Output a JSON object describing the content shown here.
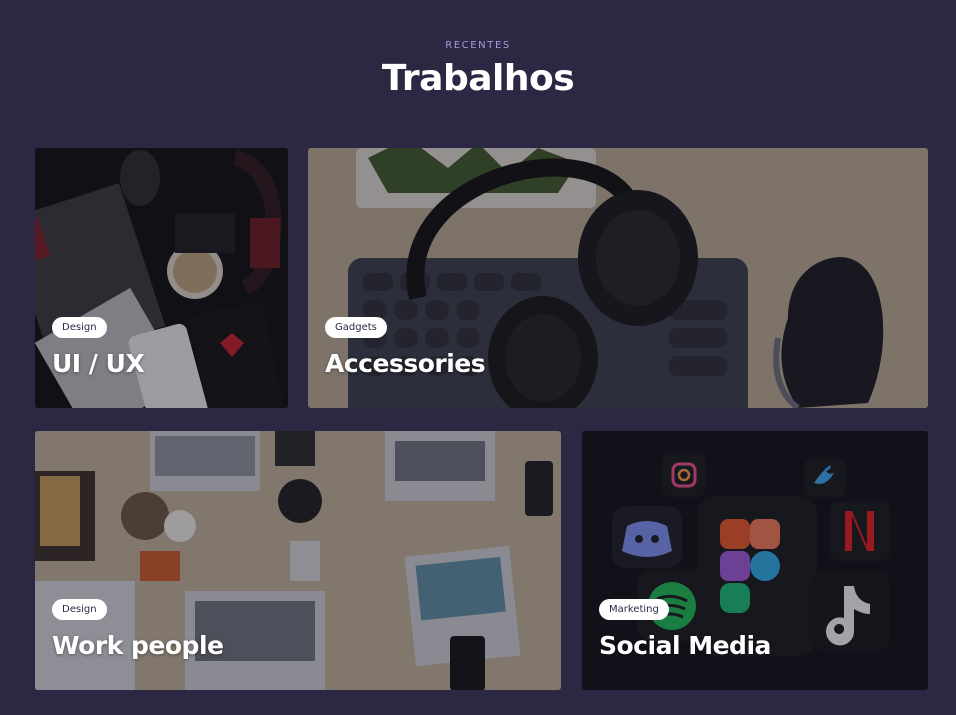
{
  "section": {
    "eyebrow": "RECENTES",
    "title": "Trabalhos"
  },
  "cards": [
    {
      "tag": "Design",
      "title": "UI / UX"
    },
    {
      "tag": "Gadgets",
      "title": "Accessories"
    },
    {
      "tag": "Design",
      "title": "Work people"
    },
    {
      "tag": "Marketing",
      "title": "Social Media"
    }
  ],
  "colors": {
    "background": "#2c2742",
    "eyebrow": "#a99ad8",
    "tag_bg": "#ffffff",
    "text": "#ffffff"
  }
}
